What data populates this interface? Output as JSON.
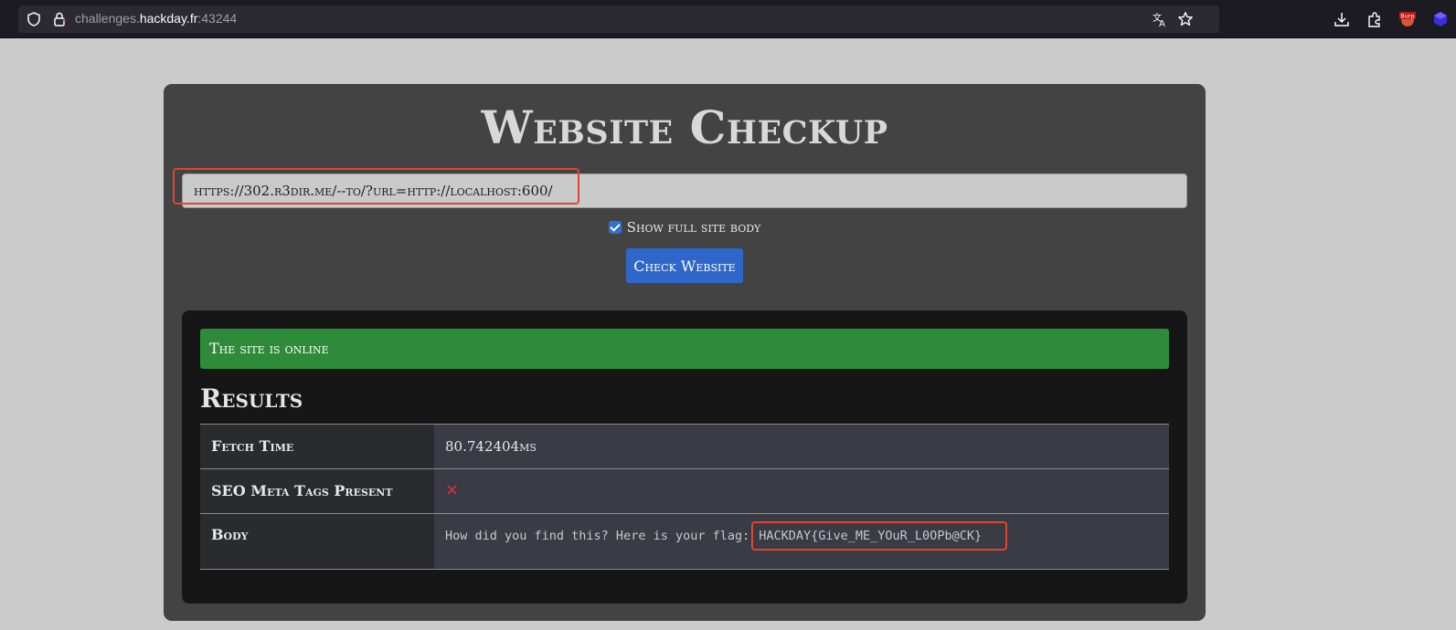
{
  "browser": {
    "url_prefix": "challenges.",
    "url_host": "hackday.fr",
    "url_port": ":43244",
    "badge_icon_text": "Burp"
  },
  "page": {
    "title": "Website Checkup",
    "url_input_value": "https://302.r3dir.me/--to/?url=http://localhost:600/",
    "show_full_body_label": "Show full site body",
    "show_full_body_checked": true,
    "check_button_label": "Check Website"
  },
  "results": {
    "alert_text": "The site is online",
    "heading": "Results",
    "rows": [
      {
        "label": "Fetch Time",
        "value": "80.742404ms"
      },
      {
        "label": "SEO Meta Tags Present",
        "value": "✕"
      },
      {
        "label": "Body",
        "value_prefix": "How did you find this? Here is your flag:",
        "flag": "HACKDAY{Give_ME_YOuR_L0OPb@CK}"
      }
    ]
  },
  "colors": {
    "page_bg": "#cbcbcb",
    "card_bg": "#434343",
    "results_bg": "#161616",
    "alert_green": "#2e8b3a",
    "button_blue": "#2f66c9",
    "highlight_red": "#e2452e",
    "fail_red": "#d7303f"
  }
}
